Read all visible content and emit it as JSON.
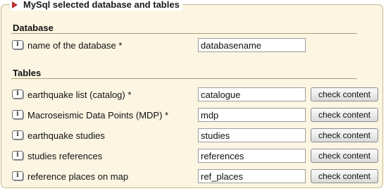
{
  "panel": {
    "title": "MySql selected database and tables"
  },
  "database_section": {
    "title": "Database",
    "row": {
      "label": "name of the database *",
      "value": "databasename",
      "info_icon": "i"
    }
  },
  "tables_section": {
    "title": "Tables",
    "rows": [
      {
        "label": "earthquake list (catalog) *",
        "value": "catalogue",
        "button": "check content",
        "info_icon": "i"
      },
      {
        "label": "Macroseismic Data Points (MDP) *",
        "value": "mdp",
        "button": "check content",
        "info_icon": "i"
      },
      {
        "label": "earthquake studies",
        "value": "studies",
        "button": "check content",
        "info_icon": "i"
      },
      {
        "label": "studies references",
        "value": "references",
        "button": "check content",
        "info_icon": "i"
      },
      {
        "label": "reference places on map",
        "value": "ref_places",
        "button": "check content",
        "info_icon": "i"
      }
    ]
  },
  "icons": {
    "legend": "collapse-triangle-icon",
    "info": "info-icon"
  },
  "colors": {
    "panel_background": "#fbf5e2",
    "panel_border": "#c9b98a",
    "triangle": "#b8312f"
  }
}
